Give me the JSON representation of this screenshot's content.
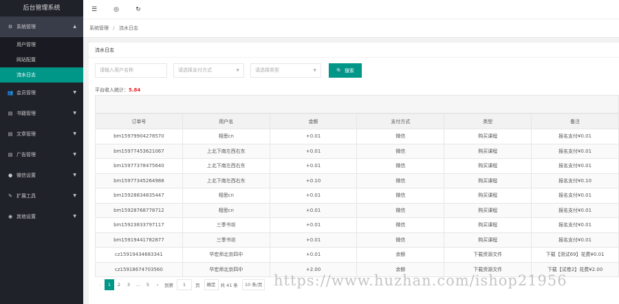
{
  "app": {
    "title": "后台管理系统"
  },
  "sidebar": {
    "groups": [
      {
        "label": "系统管理",
        "icon": "gear-icon",
        "glyph": "⚙",
        "expanded": true,
        "items": [
          {
            "label": "用户管理"
          },
          {
            "label": "网站配置"
          },
          {
            "label": "流水日志"
          }
        ]
      },
      {
        "label": "会员管理",
        "icon": "users-icon",
        "glyph": "👥"
      },
      {
        "label": "书籍管理",
        "icon": "file-icon",
        "glyph": "▤"
      },
      {
        "label": "文章管理",
        "icon": "doc-icon",
        "glyph": "▤"
      },
      {
        "label": "广告管理",
        "icon": "ad-icon",
        "glyph": "▤"
      },
      {
        "label": "微信设置",
        "icon": "wechat-icon",
        "glyph": "●"
      },
      {
        "label": "扩展工具",
        "icon": "tools-icon",
        "glyph": "✎"
      },
      {
        "label": "其他设置",
        "icon": "settings-icon",
        "glyph": "◉"
      }
    ]
  },
  "topbar": {
    "icons": [
      "menu-toggle-icon",
      "globe-icon",
      "refresh-icon"
    ],
    "glyphs": [
      "☰",
      "◎",
      "↻"
    ]
  },
  "breadcrumb": {
    "parent": "系统管理",
    "separator": "/",
    "current": "流水日志"
  },
  "card": {
    "title": "流水日志",
    "filters": {
      "username_placeholder": "请输入用户名称",
      "pay_select": "请选择支付方式",
      "type_select": "请选择类型",
      "search_label": "搜索"
    },
    "stat": {
      "label": "平台收入统计：",
      "value": "5.84"
    }
  },
  "table": {
    "columns": [
      "订单号",
      "用户名",
      "金额",
      "支付方式",
      "类型",
      "备注"
    ],
    "rows": [
      [
        "bm15979904278570",
        "相思cn",
        "+0.01",
        "微信",
        "购买课程",
        "报名支付¥0.01"
      ],
      [
        "bm15977453621067",
        "上北下南左西右东",
        "+0.01",
        "微信",
        "购买课程",
        "报名支付¥0.01"
      ],
      [
        "bm15977378475640",
        "上北下南左西右东",
        "+0.01",
        "微信",
        "购买课程",
        "报名支付¥0.01"
      ],
      [
        "bm15977345264988",
        "上北下南左西右东",
        "+0.10",
        "微信",
        "购买课程",
        "报名支付¥0.10"
      ],
      [
        "bm15928834835447",
        "相思cn",
        "+0.01",
        "微信",
        "购买课程",
        "报名支付¥0.01"
      ],
      [
        "bm15928768778712",
        "相思cn",
        "+0.01",
        "微信",
        "购买课程",
        "报名支付¥0.01"
      ],
      [
        "bm15923833797117",
        "三季书坊",
        "+0.01",
        "微信",
        "购买课程",
        "报名支付¥0.01"
      ],
      [
        "bm15919441782877",
        "三季书坊",
        "+0.01",
        "微信",
        "购买课程",
        "报名支付¥0.01"
      ],
      [
        "cz15919434683341",
        "华宏师北京四中",
        "+0.01",
        "余额",
        "下载资源文件",
        "下载【测试69】花费¥0.01"
      ],
      [
        "cz15918674703560",
        "华宏师北京四中",
        "+2.00",
        "余额",
        "下载资源文件",
        "下载【试卷2】花费¥2.00"
      ]
    ]
  },
  "pager": {
    "prev": "‹",
    "pages": [
      "1",
      "2",
      "3",
      "…",
      "5"
    ],
    "next": "›",
    "goto_label": "到第",
    "goto_value": "1",
    "page_unit": "页",
    "confirm": "确定",
    "total": "共 41 条",
    "size": "10 条/页"
  },
  "watermark": "https://www.huzhan.com/ishop21956"
}
